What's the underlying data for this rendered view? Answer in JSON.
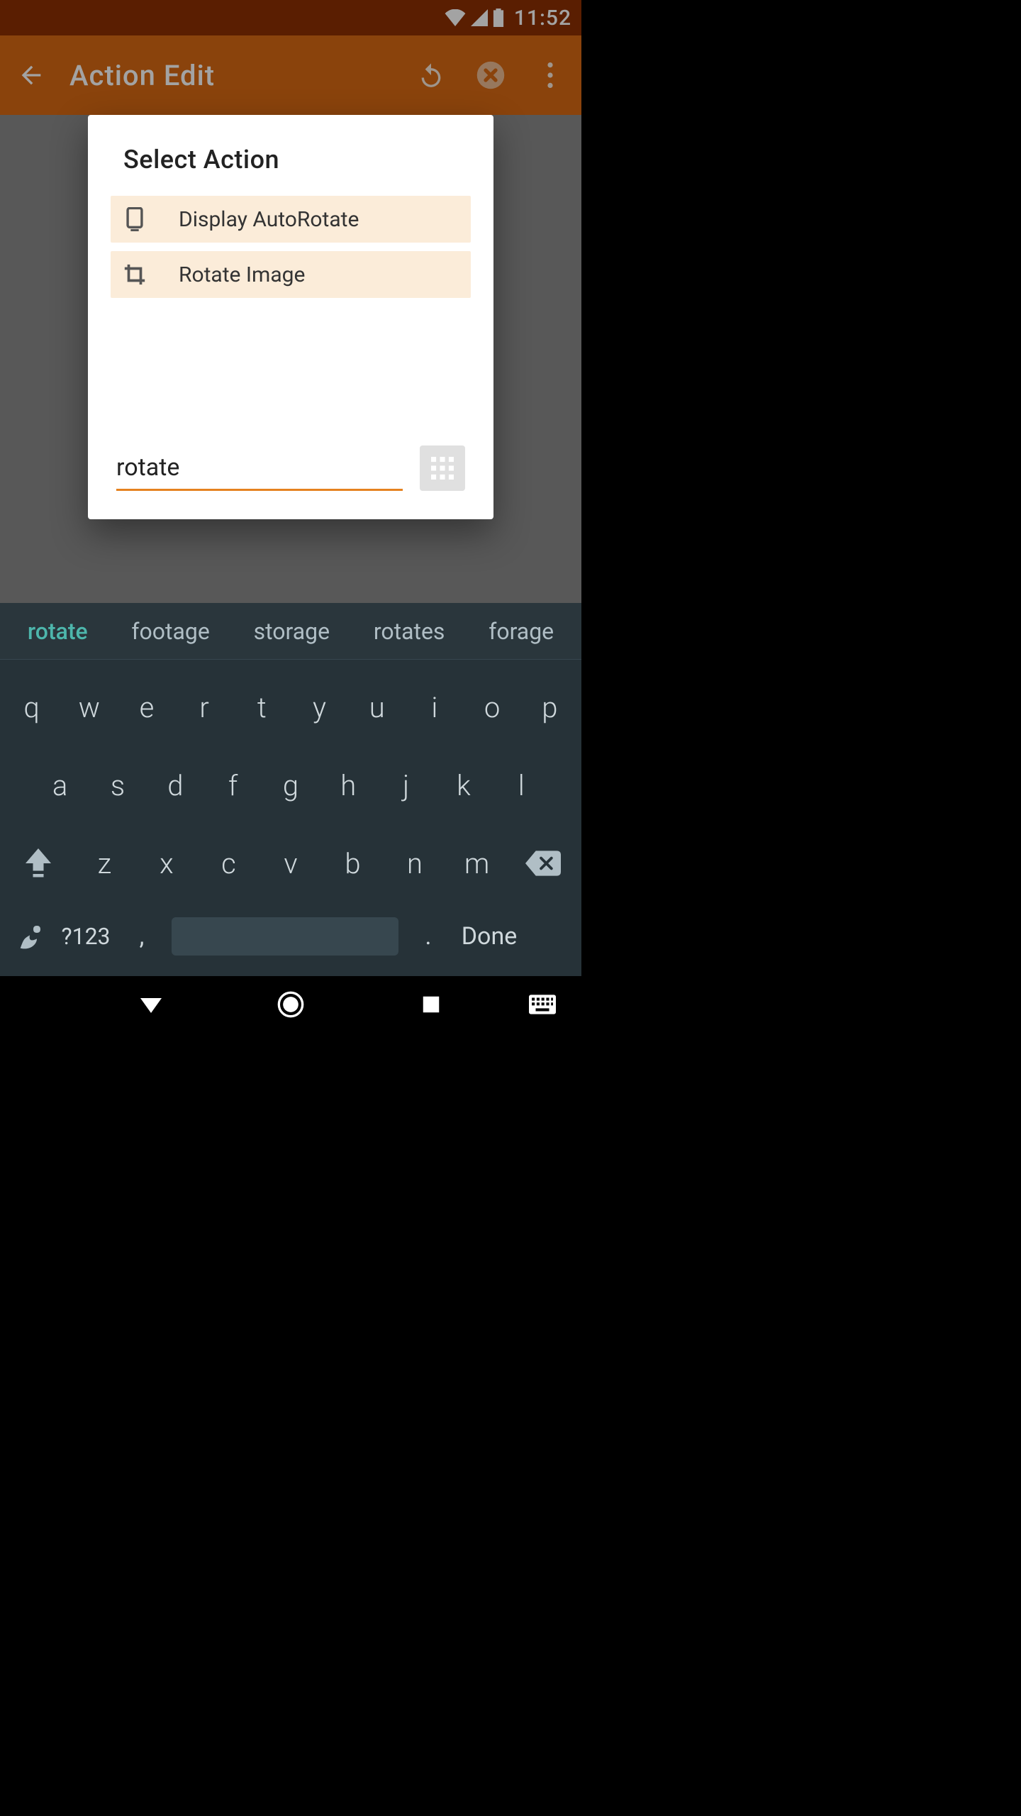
{
  "status": {
    "time": "11:52"
  },
  "appbar": {
    "title": "Action Edit"
  },
  "dialog": {
    "title": "Select  Action",
    "items": [
      {
        "label": "Display AutoRotate"
      },
      {
        "label": "Rotate Image"
      }
    ],
    "search_value": "rotate"
  },
  "keyboard": {
    "suggestions": [
      "rotate",
      "footage",
      "storage",
      "rotates",
      "forage"
    ],
    "row1": [
      "q",
      "w",
      "e",
      "r",
      "t",
      "y",
      "u",
      "i",
      "o",
      "p"
    ],
    "row2": [
      "a",
      "s",
      "d",
      "f",
      "g",
      "h",
      "j",
      "k",
      "l"
    ],
    "row3": [
      "z",
      "x",
      "c",
      "v",
      "b",
      "n",
      "m"
    ],
    "sym": "?123",
    "comma": ",",
    "dot": ".",
    "done": "Done"
  }
}
